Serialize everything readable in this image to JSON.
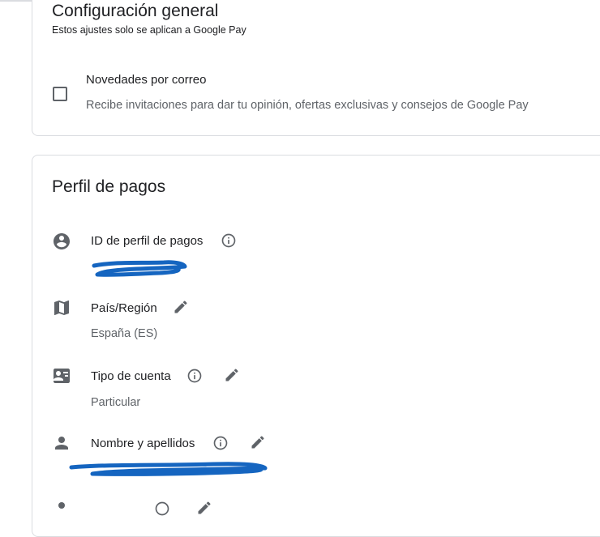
{
  "general": {
    "title": "Configuración general",
    "subtitle": "Estos ajustes solo se aplican a Google Pay",
    "email_option": {
      "checked": false,
      "title": "Novedades por correo",
      "description": "Recibe invitaciones para dar tu opinión, ofertas exclusivas y consejos de Google Pay"
    }
  },
  "profile": {
    "title": "Perfil de pagos",
    "rows": [
      {
        "icon": "account-circle-icon",
        "label": "ID de perfil de pagos",
        "info": true,
        "edit": false,
        "value": "[redacted]"
      },
      {
        "icon": "map-icon",
        "label": "País/Región",
        "info": false,
        "edit": true,
        "value": "España (ES)"
      },
      {
        "icon": "contact-card-icon",
        "label": "Tipo de cuenta",
        "info": true,
        "edit": true,
        "value": "Particular"
      },
      {
        "icon": "person-icon",
        "label": "Nombre y apellidos",
        "info": true,
        "edit": true,
        "value": "[redacted]"
      }
    ]
  },
  "colors": {
    "text_primary": "#202124",
    "text_secondary": "#5f6368",
    "icon": "#5f6368",
    "border": "#dadce0",
    "redaction": "#1565c0"
  }
}
